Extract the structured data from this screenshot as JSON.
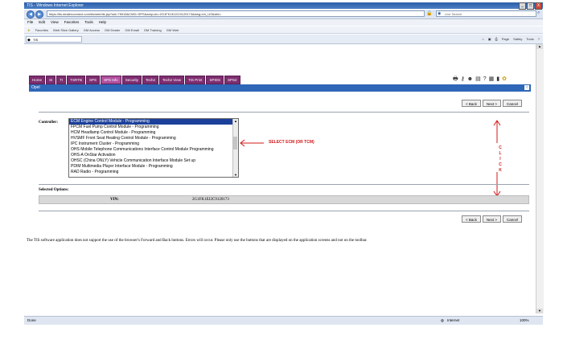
{
  "window": {
    "title": "TIS - Windows Internet Explorer",
    "controls": [
      "_",
      "□",
      "X"
    ]
  },
  "browser": {
    "address": "https://tis.dealerconnect.com/tis/web/tis.jsp?sid=75918&CMD=SPS&amp;vin=2G1FK1EJ2C9120173&lang=en_US&site=",
    "search_placeholder": "Live Search",
    "menu": [
      "File",
      "Edit",
      "View",
      "Favorites",
      "Tools",
      "Help"
    ],
    "favorites": [
      "Favorites",
      "Web Slice Gallery",
      "GM Access",
      "GM Dealer",
      "GM Email",
      "GM Training",
      "GM Web"
    ],
    "tab_label": "TIS",
    "commands": [
      "Page",
      "Safety",
      "Tools"
    ],
    "status_left": "Done",
    "status_zone": "Internet",
    "zoom": "100%"
  },
  "app": {
    "tabs": [
      {
        "label": "Home",
        "active": false
      },
      {
        "label": "SI",
        "active": false
      },
      {
        "label": "TI",
        "active": false
      },
      {
        "label": "TSRTB",
        "active": false
      },
      {
        "label": "SPS",
        "active": false
      },
      {
        "label": "SPS Info",
        "active": true
      },
      {
        "label": "Security",
        "active": false
      },
      {
        "label": "Tech2",
        "active": false
      },
      {
        "label": "Tech2 View",
        "active": false
      },
      {
        "label": "TIS Print",
        "active": false
      },
      {
        "label": "SPIDS",
        "active": false
      },
      {
        "label": "SPS2",
        "active": false
      }
    ],
    "icons": [
      "printer-icon",
      "key-icon",
      "person-icon",
      "calendar-icon",
      "help-icon",
      "document-icon",
      "chart-icon",
      "gear-icon"
    ],
    "icon_glyphs": [
      "🖶",
      "⚷",
      "☻",
      "▤",
      "?",
      "▦",
      "▮",
      "✿"
    ],
    "brand": "Opel",
    "buttons": {
      "back": "< Back",
      "next": "Next >",
      "cancel": "Cancel"
    },
    "controller_label": "Controller:",
    "controllers": [
      "ECM Engine Control Module - Programming",
      "FPCM Fuel Pump Control Module - Programming",
      "HCM Headlamp Control Module - Programming",
      "HVSMF Front Seat Heating Control Module - Programming",
      "IPC Instrument Cluster - Programming",
      "OHS Mobile Telephone Communications Interface Control Module Programming",
      "OHS-A OnStar Activation",
      "OHSC (China ONLY) Vehicle Communication Interface Module Set up",
      "PDIM Multimedia Player Interface Module - Programming",
      "RAD Radio - Programming"
    ],
    "selected_index": 0,
    "annotation": "SELECT ECM (OR TCM)",
    "click_letters": [
      "C",
      "L",
      "I",
      "C",
      "K"
    ],
    "selected_options_label": "Selected Options:",
    "vin_label": "VIN:",
    "vin_value": "2G1FK1EJ2C9120173",
    "note": "The TIS software application does not support the use of the browser's Forward and Back buttons. Errors will occur. Please only use the buttons that are displayed on the application screens and not on the toolbar."
  },
  "colors": {
    "tab_bg": "#7e2d70",
    "tab_active": "#b24fa0",
    "brand_bar": "#2e66b8",
    "selection": "#1b3f9a",
    "annotation": "#d11818"
  }
}
